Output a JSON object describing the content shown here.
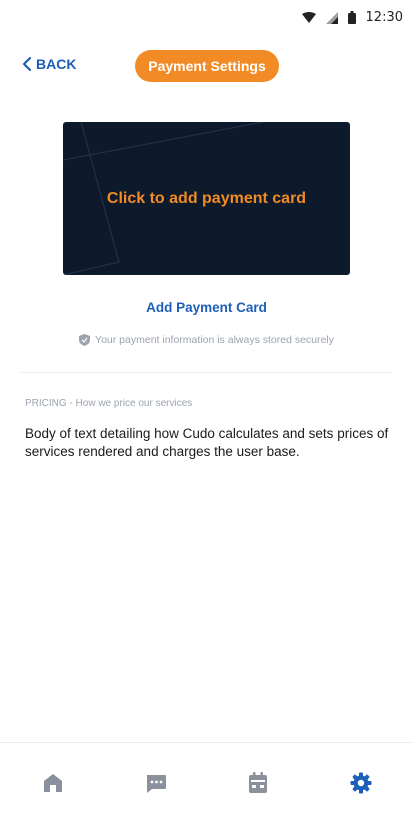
{
  "status_bar": {
    "time": "12:30",
    "icons": [
      "wifi-icon",
      "signal-icon",
      "battery-icon"
    ]
  },
  "header": {
    "back_label": "BACK",
    "title": "Payment Settings"
  },
  "card": {
    "prompt": "Click to add payment card"
  },
  "add_card_link": "Add Payment Card",
  "secure_note": "Your payment information is always stored securely",
  "pricing": {
    "label": "PRICING - How we price our services",
    "body": "Body of text detailing how Cudo calculates and sets prices of services rendered and charges the user base."
  },
  "bottom_nav": {
    "items": [
      "home-icon",
      "chat-icon",
      "calendar-icon",
      "settings-icon"
    ],
    "active": "settings-icon"
  },
  "colors": {
    "accent": "#f28b25",
    "link": "#1d5fb8",
    "card_bg": "#0d1a2b",
    "muted": "#9ca3af",
    "nav_inactive": "#8a919c"
  }
}
